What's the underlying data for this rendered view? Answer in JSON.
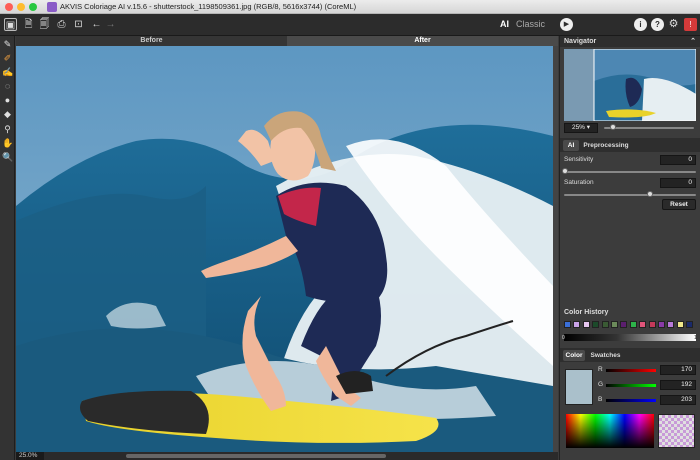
{
  "window": {
    "title": "AKVIS Coloriage AI v.15.6 - shutterstock_1198509361.jpg (RGB/8, 5616x3744) (CoreML)"
  },
  "toolbar": {
    "mode_ai": "AI",
    "mode_classic": "Classic"
  },
  "view_tabs": [
    "Before",
    "After"
  ],
  "status": {
    "zoom": "25.0%"
  },
  "navigator": {
    "title": "Navigator",
    "zoom_value": "25%",
    "zoom_level": 0.1
  },
  "settings": {
    "tabs": [
      "AI",
      "Preprocessing"
    ],
    "sensitivity_label": "Sensitivity",
    "sensitivity_value": "0",
    "saturation_label": "Saturation",
    "saturation_value": "0",
    "saturation_level": 0.65,
    "reset_label": "Reset"
  },
  "color_history": {
    "title": "Color History",
    "swatches": [
      "#3a6fd8",
      "#c9a2e8",
      "#e6c6ef",
      "#1c4a2a",
      "#3a5a34",
      "#6b8a5a",
      "#5b1e6e",
      "#2db34a",
      "#e0557a",
      "#c43a5a",
      "#8a3aa8",
      "#b77ad8",
      "#f0e88a",
      "#1a2a6a"
    ],
    "scale_start": "0",
    "scale_end": "1"
  },
  "color": {
    "tabs": [
      "Color",
      "Swatches"
    ],
    "r_label": "R",
    "r_value": "170",
    "g_label": "G",
    "g_value": "192",
    "b_label": "B",
    "b_value": "203",
    "current": "#aac0cb"
  }
}
